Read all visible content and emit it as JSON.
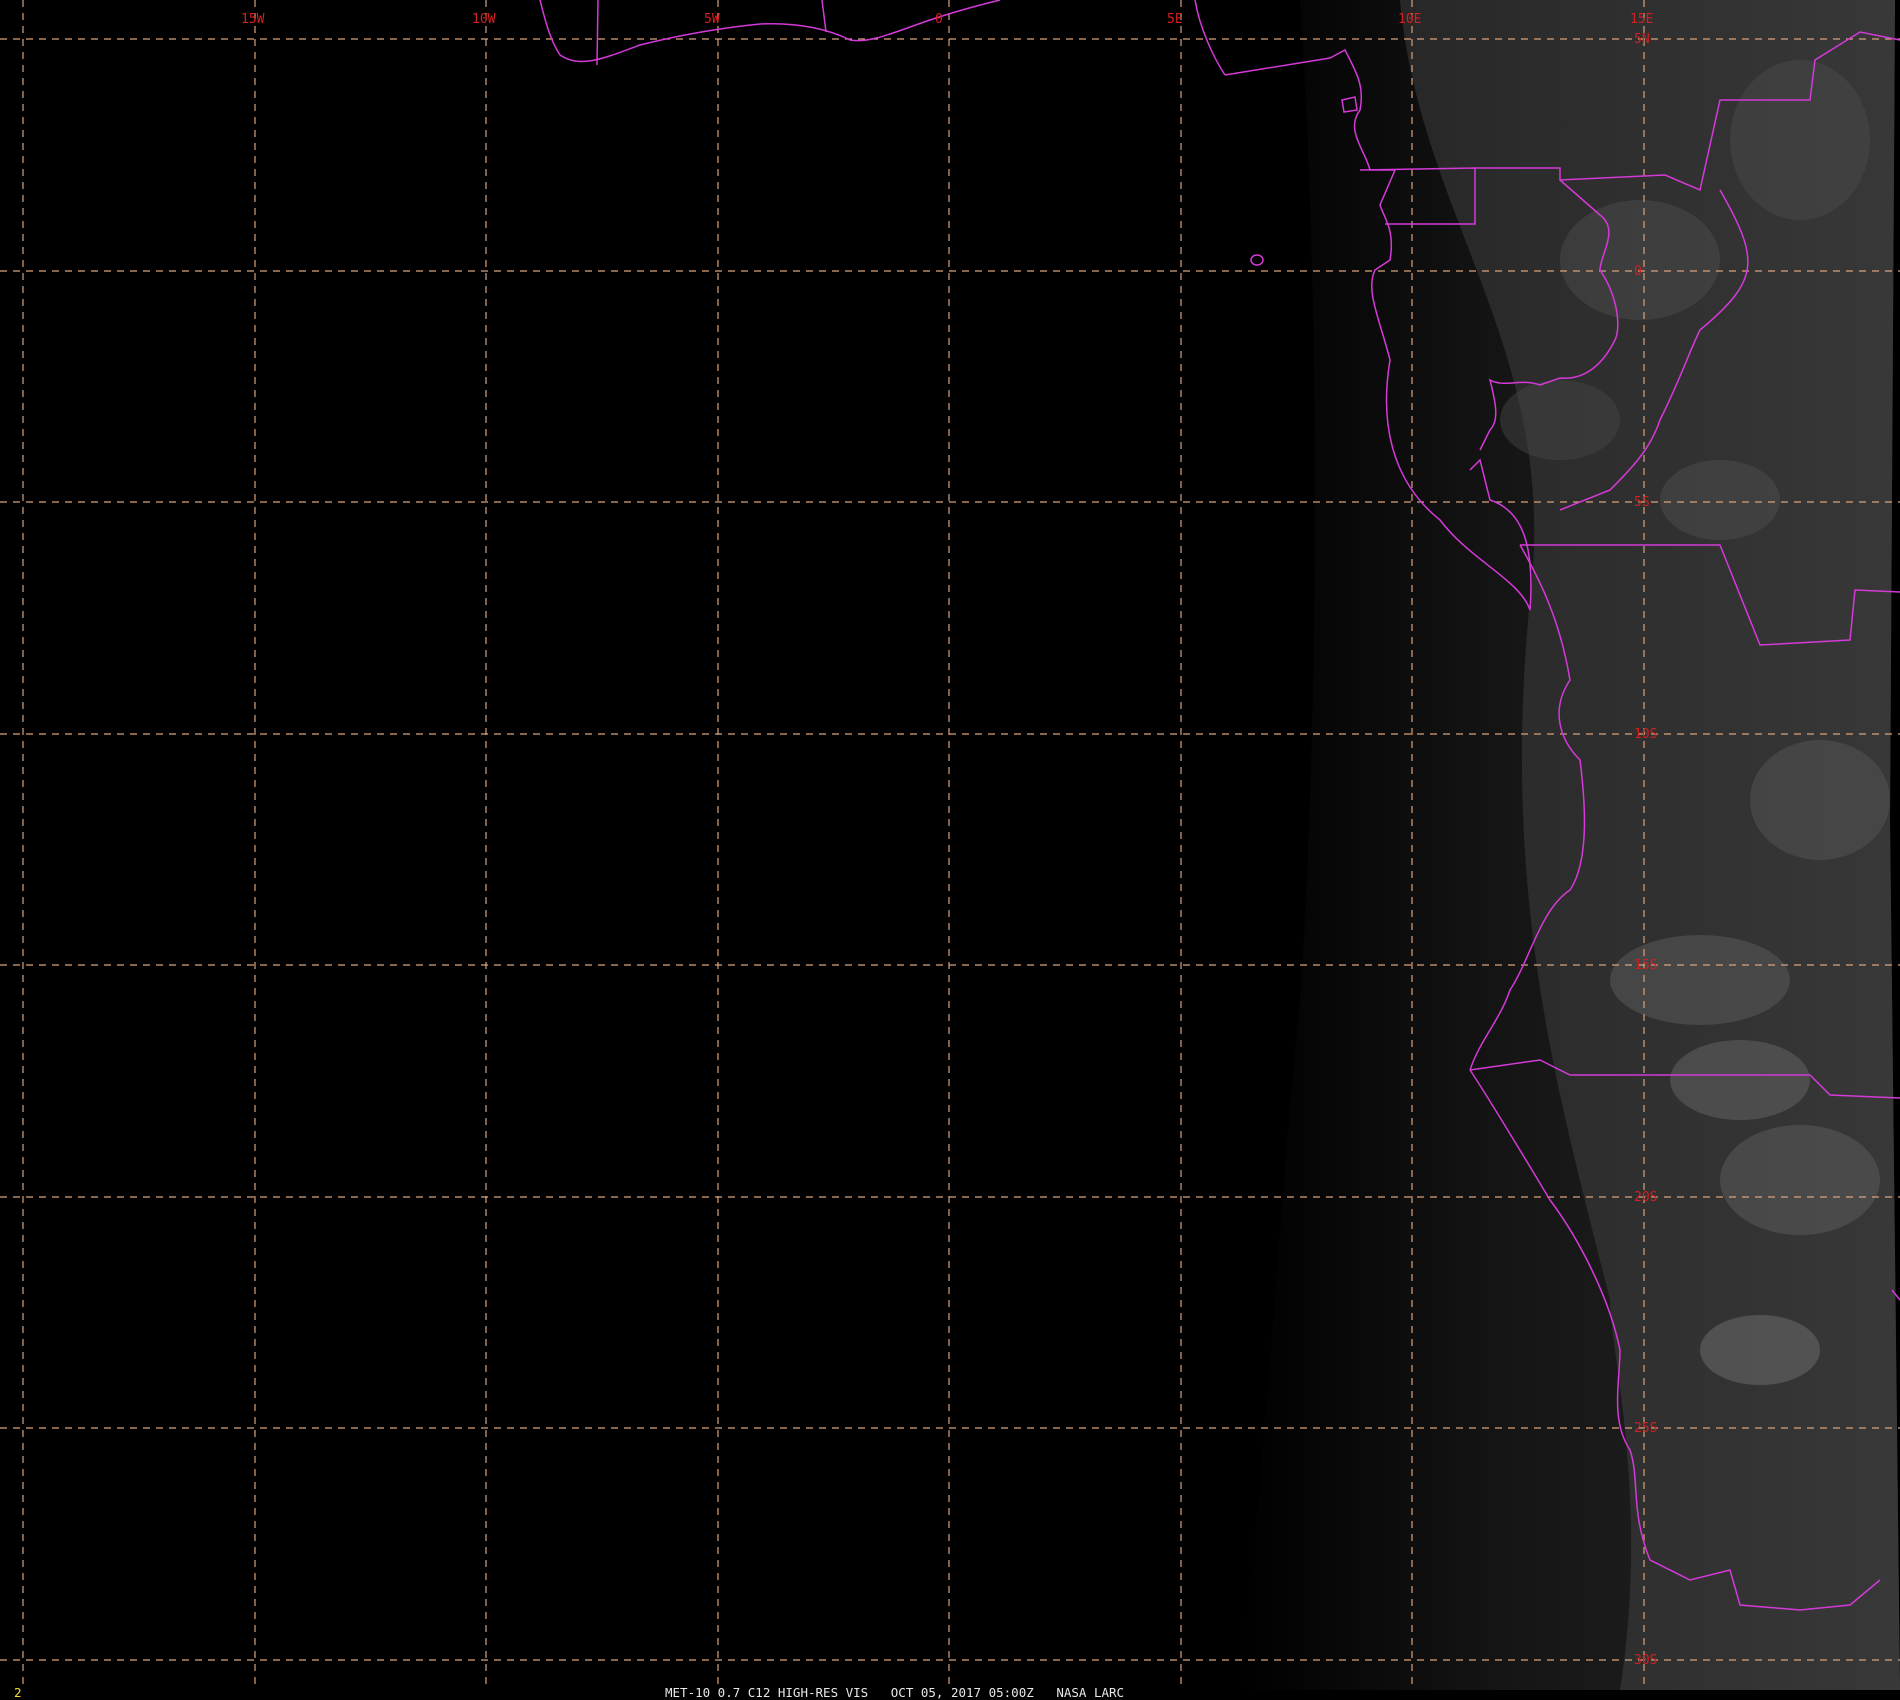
{
  "longitude_labels": [
    "15W",
    "10W",
    "5W",
    "0",
    "5E",
    "10E",
    "15E"
  ],
  "latitude_labels": [
    "5N",
    "0",
    "5S",
    "10S",
    "15S",
    "20S",
    "25S",
    "30S"
  ],
  "caption": "MET-10 0.7 C12 HIGH-RES VIS   OCT 05, 2017 05:00Z   NASA LARC",
  "frame_number": "2",
  "colors": {
    "background": "#000000",
    "graticule": "#d9a27a",
    "coastline": "#d43ad8",
    "coordinate_labels": "#d42020",
    "caption": "#e8e8e8",
    "frame_number": "#f0e030"
  }
}
